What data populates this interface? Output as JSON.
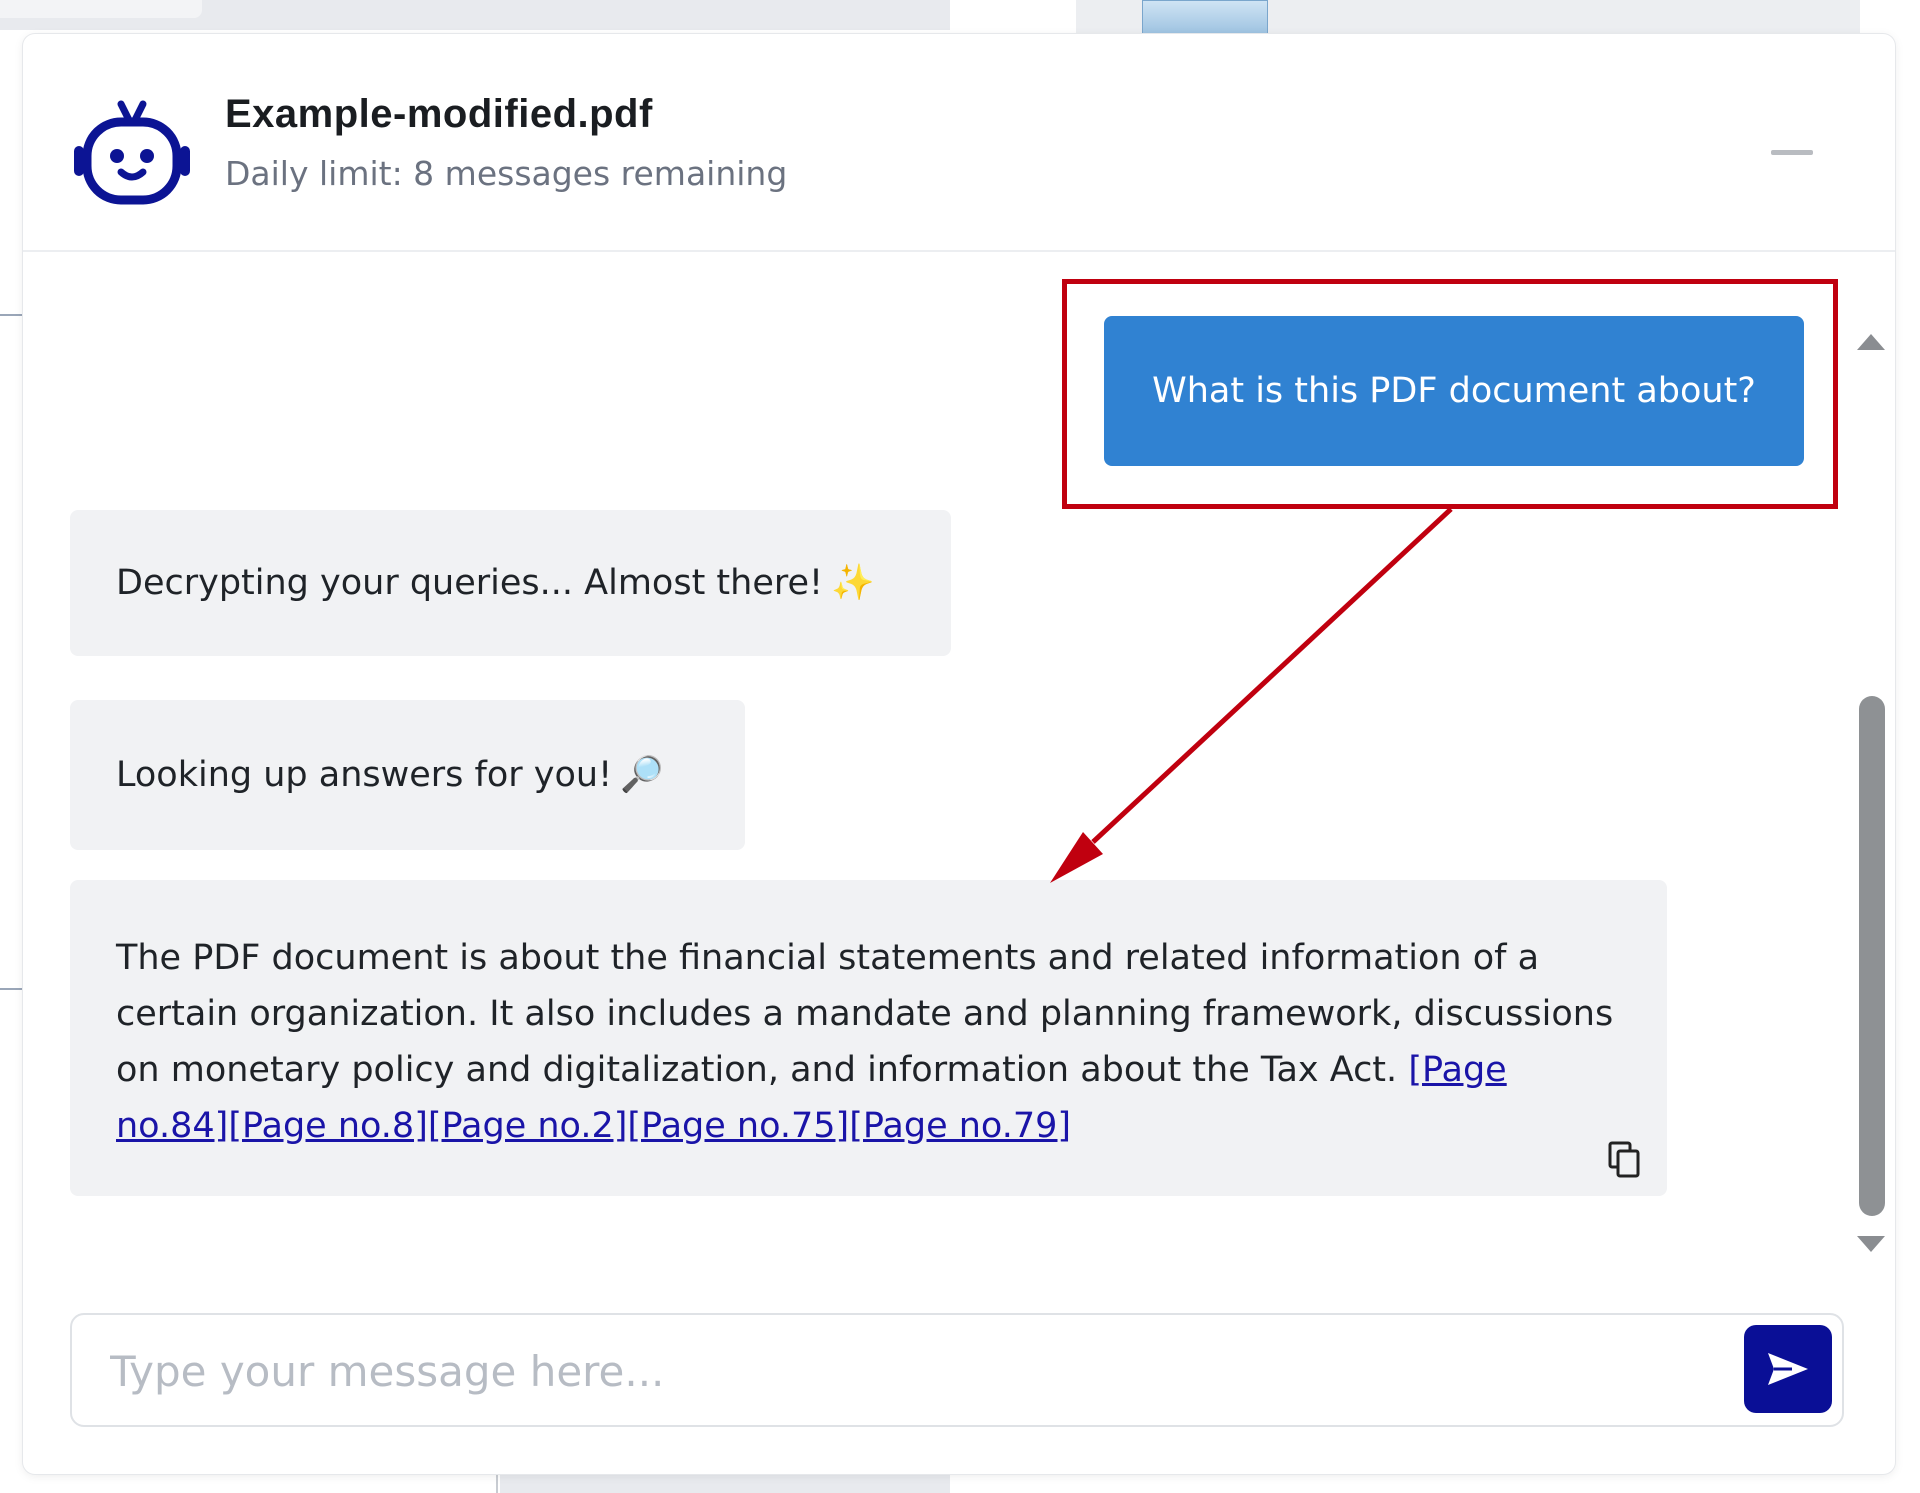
{
  "header": {
    "file_name": "Example-modified.pdf",
    "daily_limit": "Daily limit: 8 messages remaining",
    "bot_icon": "robot-icon",
    "minimize_icon": "minimize-icon"
  },
  "messages": {
    "user_question": "What is this PDF document about?",
    "status_1": "Decrypting your queries... Almost there!",
    "status_1_emoji": "✨",
    "status_2": "Looking up answers for you!",
    "status_2_emoji": "🔎",
    "answer_text": "The PDF document is about the financial statements and related information of a certain organization. It also includes a mandate and planning framework, discussions on monetary policy and digitalization, and information about the Tax Act.",
    "page_links": [
      "[Page no.84]",
      "[Page no.8]",
      "[Page no.2]",
      "[Page no.75]",
      "[Page no.79]"
    ],
    "copy_icon": "copy-icon"
  },
  "input": {
    "placeholder": "Type your message here...",
    "value": "",
    "send_icon": "send-icon"
  },
  "colors": {
    "user_bubble": "#3082d2",
    "bot_bubble": "#f1f2f4",
    "send_button": "#0a0f96",
    "annotation": "#c0000f",
    "link": "#1a14a8"
  }
}
